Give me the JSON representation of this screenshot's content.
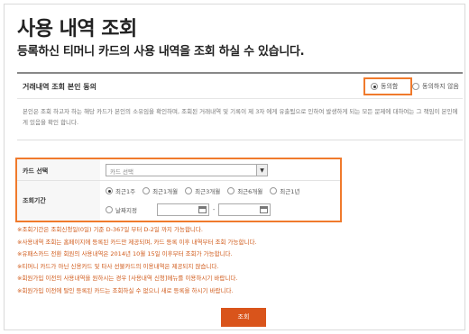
{
  "page": {
    "title": "사용 내역 조회",
    "subtitle": "등록하신 티머니 카드의 사용 내역을 조회 하실 수 있습니다."
  },
  "consent": {
    "label": "거래내역 조회 본인 동의",
    "agree_label": "동의함",
    "disagree_label": "동의하지 않음",
    "agree_selected": true,
    "text": "본인은 조회 하고자 하는 해당 카드가 본인의 소유임을 확인하며, 조회된 거래내역 및 기록이 제 3자 에게 유출됨으로 인하여 발생하게 되는 모든 문제에 대하여는 그 책임이 본인에게 있음을 확인 합니다."
  },
  "search": {
    "card_label": "카드 선택",
    "card_select_value": "카드 선택",
    "period_label": "조회기간",
    "period_options": [
      "최근1주",
      "최근1개월",
      "최근3개월",
      "최근6개월",
      "최근1년"
    ],
    "selected_period": "최근1주",
    "date_option_label": "날짜지정",
    "date_separator": "-"
  },
  "notes": [
    "※조회기간은 조회신청일(0일) 기준 D-367일 부터 D-2일 까지 가능합니다.",
    "※사용내역 조회는 홈페이지에 등록된 카드만 제공되며, 카드 등록 이후 내역부터 조회 가능합니다.",
    "※유패스카드 전환 회원의 사용내역은 2014년 10월 15일 이후부터 조회가 가능합니다.",
    "※티머니 카드가 아닌 신용카드 및 타사 선불카드의 이용내역은 제공되지 않습니다.",
    "※회원가입 이전의 사용내역을 원하시는 경우 [사용내역 신청]메뉴를 이용하시기 바랍니다.",
    "※회원가입 이전에 탈인 등록된 카드는 조회하실 수 없으니 새로 등록을 하시기 바랍니다."
  ],
  "submit_label": "조회",
  "colors": {
    "accent": "#f07a2c",
    "button": "#d9541b",
    "note_text": "#d05a1a"
  }
}
